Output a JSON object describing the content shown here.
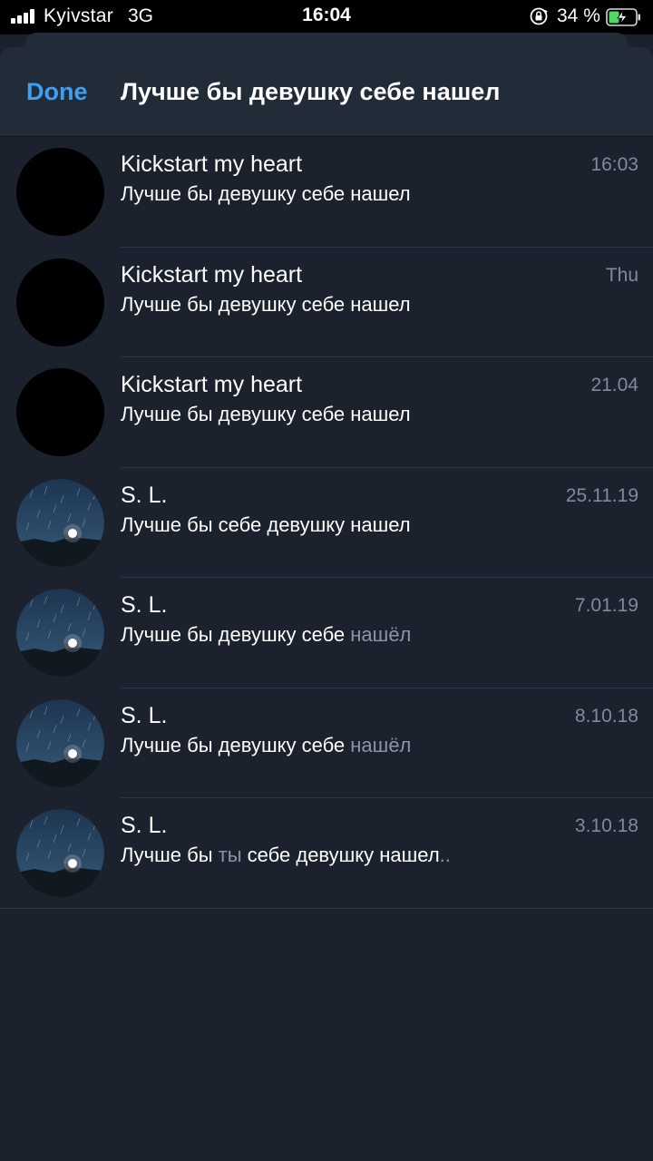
{
  "status_bar": {
    "carrier": "Kyivstar",
    "network": "3G",
    "time": "16:04",
    "battery": "34 %",
    "signal_icon": "signal-bars-icon",
    "lock_icon": "orientation-lock-icon",
    "battery_icon": "battery-charging-icon"
  },
  "nav": {
    "done_label": "Done",
    "title": "Лучше бы девушку себе нашел"
  },
  "colors": {
    "accent": "#3e9ff2",
    "background": "#1b222d",
    "nav_background": "#222c39",
    "secondary_text": "#7f8b98"
  },
  "results": [
    {
      "name": "Kickstart my heart",
      "time": "16:03",
      "avatar": "black",
      "msg": [
        {
          "t": "Лучше бы девушку себе нашел",
          "dim": false
        }
      ]
    },
    {
      "name": "Kickstart my heart",
      "time": "Thu",
      "avatar": "black",
      "msg": [
        {
          "t": "Лучше бы девушку себе нашел",
          "dim": false
        }
      ]
    },
    {
      "name": "Kickstart my heart",
      "time": "21.04",
      "avatar": "black",
      "msg": [
        {
          "t": "Лучше бы девушку себе нашел",
          "dim": false
        }
      ]
    },
    {
      "name": "S. L.",
      "time": "25.11.19",
      "avatar": "night-sky",
      "msg": [
        {
          "t": "Лучше бы себе девушку нашел",
          "dim": false
        }
      ]
    },
    {
      "name": "S. L.",
      "time": "7.01.19",
      "avatar": "night-sky",
      "msg": [
        {
          "t": "Лучше бы девушку себе ",
          "dim": false
        },
        {
          "t": "нашёл",
          "dim": true
        }
      ]
    },
    {
      "name": "S. L.",
      "time": "8.10.18",
      "avatar": "night-sky",
      "msg": [
        {
          "t": "Лучше бы девушку себе ",
          "dim": false
        },
        {
          "t": "нашёл",
          "dim": true
        }
      ]
    },
    {
      "name": "S. L.",
      "time": "3.10.18",
      "avatar": "night-sky",
      "msg": [
        {
          "t": "Лучше бы ",
          "dim": false
        },
        {
          "t": "ты",
          "dim": true
        },
        {
          "t": " себе девушку нашел",
          "dim": false
        },
        {
          "t": "..",
          "dim": true
        }
      ]
    }
  ]
}
